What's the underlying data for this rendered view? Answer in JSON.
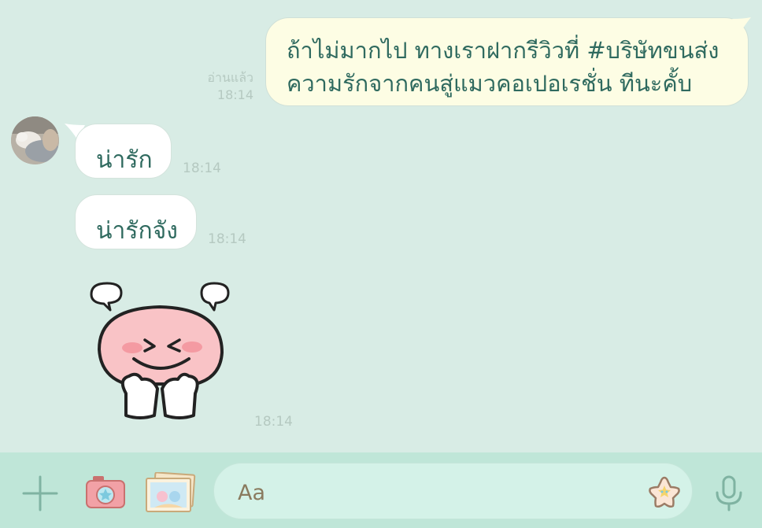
{
  "messages": {
    "outgoing": {
      "line1": "ถ้าไม่มากไป ทางเราฝากรีวิวที่ #บริษัทขนส่ง",
      "line2": "ความรักจากคนสู่แมวคอเปอเรชั่น ทีนะคั้บ",
      "read_label": "อ่านแล้ว",
      "time": "18:14"
    },
    "incoming": [
      {
        "text": "น่ารัก",
        "time": "18:14"
      },
      {
        "text": "น่ารักจัง",
        "time": "18:14"
      }
    ],
    "sticker": {
      "time": "18:14"
    }
  },
  "input": {
    "placeholder": "Aa"
  },
  "colors": {
    "chat_background": "#d8ece5",
    "bottom_bar": "#bfe6d8",
    "outgoing_bubble": "#fdfde4",
    "incoming_bubble": "#ffffff",
    "message_text": "#2f6a5f",
    "timestamp": "#b5c9c1",
    "icon_green": "#7fb3a2"
  },
  "icons": {
    "add": "plus-icon",
    "camera": "camera-icon",
    "album": "photo-album-icon",
    "emoji": "star-emoji-icon",
    "mic": "microphone-icon"
  }
}
